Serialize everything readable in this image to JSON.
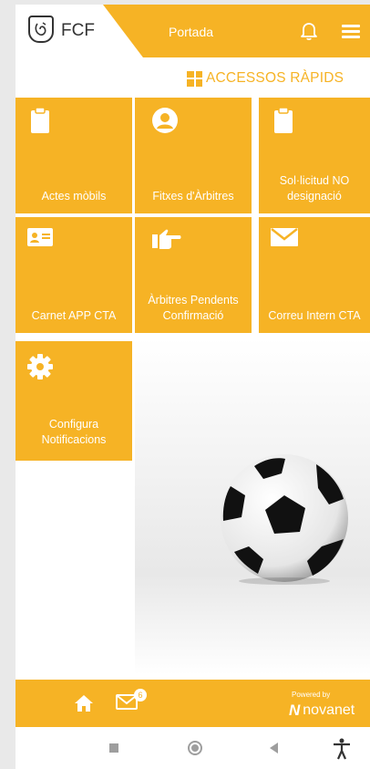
{
  "header": {
    "brand": "FCF",
    "title": "Portada"
  },
  "section": {
    "title": "ACCESSOS RÀPIDS"
  },
  "tiles": [
    {
      "label": "Actes mòbils",
      "icon": "clipboard-icon"
    },
    {
      "label": "Fitxes d'Àrbitres",
      "icon": "user-circle-icon"
    },
    {
      "label": "Sol·licitud NO designació",
      "icon": "clipboard-icon"
    },
    {
      "label": "Carnet APP CTA",
      "icon": "id-card-icon"
    },
    {
      "label": "Àrbitres Pendents Confirmació",
      "icon": "hand-pointing-icon"
    },
    {
      "label": "Correu Intern CTA",
      "icon": "envelope-icon"
    },
    {
      "label": "Configura Notificacions",
      "icon": "gear-icon"
    }
  ],
  "footer": {
    "mail_badge": "6",
    "powered_by": "Powered by",
    "vendor": "novanet"
  },
  "colors": {
    "accent": "#f6b325",
    "white": "#ffffff"
  }
}
